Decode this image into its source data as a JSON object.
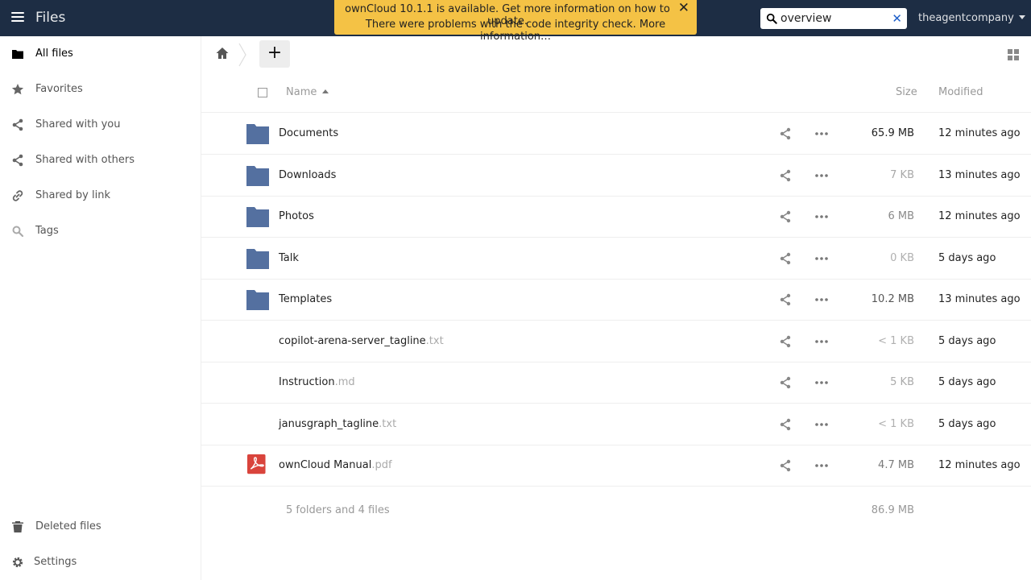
{
  "header": {
    "app_title": "Files",
    "menu_icon": "hamburger-menu-icon",
    "notification": {
      "line1": "ownCloud 10.1.1 is available. Get more information on how to update.",
      "line2": "There were problems with the code integrity check. More information…",
      "close": "✕"
    },
    "search": {
      "value": "overview",
      "clear": "✕"
    },
    "user": "theagentcompany"
  },
  "sidebar": {
    "items": [
      {
        "label": "All files",
        "icon": "folder-icon",
        "active": true
      },
      {
        "label": "Favorites",
        "icon": "star-icon"
      },
      {
        "label": "Shared with you",
        "icon": "share-icon"
      },
      {
        "label": "Shared with others",
        "icon": "share-icon"
      },
      {
        "label": "Shared by link",
        "icon": "link-icon"
      },
      {
        "label": "Tags",
        "icon": "search-icon"
      }
    ],
    "bottom": [
      {
        "label": "Deleted files",
        "icon": "trash-icon"
      },
      {
        "label": "Settings",
        "icon": "gear-icon"
      }
    ]
  },
  "controls": {
    "new_label": "+"
  },
  "table": {
    "headers": {
      "name": "Name",
      "size": "Size",
      "modified": "Modified"
    },
    "rows": [
      {
        "name": "Documents",
        "ext": "",
        "type": "folder",
        "size": "65.9 MB",
        "modified": "12 minutes ago",
        "size_color": "#222222"
      },
      {
        "name": "Downloads",
        "ext": "",
        "type": "folder",
        "size": "7 KB",
        "modified": "13 minutes ago",
        "size_color": "#a8a8a8"
      },
      {
        "name": "Photos",
        "ext": "",
        "type": "folder",
        "size": "6 MB",
        "modified": "12 minutes ago",
        "size_color": "#8a8a8a"
      },
      {
        "name": "Talk",
        "ext": "",
        "type": "folder",
        "size": "0 KB",
        "modified": "5 days ago",
        "size_color": "#b0b0b0"
      },
      {
        "name": "Templates",
        "ext": "",
        "type": "folder",
        "size": "10.2 MB",
        "modified": "13 minutes ago",
        "size_color": "#555555"
      },
      {
        "name": "copilot-arena-server_tagline",
        "ext": ".txt",
        "type": "text",
        "size": "< 1 KB",
        "modified": "5 days ago",
        "size_color": "#b0b0b0"
      },
      {
        "name": "Instruction",
        "ext": ".md",
        "type": "text",
        "size": "5 KB",
        "modified": "5 days ago",
        "size_color": "#aaaaaa"
      },
      {
        "name": "janusgraph_tagline",
        "ext": ".txt",
        "type": "text",
        "size": "< 1 KB",
        "modified": "5 days ago",
        "size_color": "#b0b0b0"
      },
      {
        "name": "ownCloud Manual",
        "ext": ".pdf",
        "type": "pdf",
        "size": "4.7 MB",
        "modified": "12 minutes ago",
        "size_color": "#7a7a7a"
      }
    ],
    "summary": {
      "text": "5 folders and 4 files",
      "size": "86.9 MB"
    }
  },
  "colors": {
    "header_bg": "#1d2d44",
    "folder": "#5470a0",
    "notification_bg": "#f4c245",
    "pdf": "#d9443c"
  }
}
